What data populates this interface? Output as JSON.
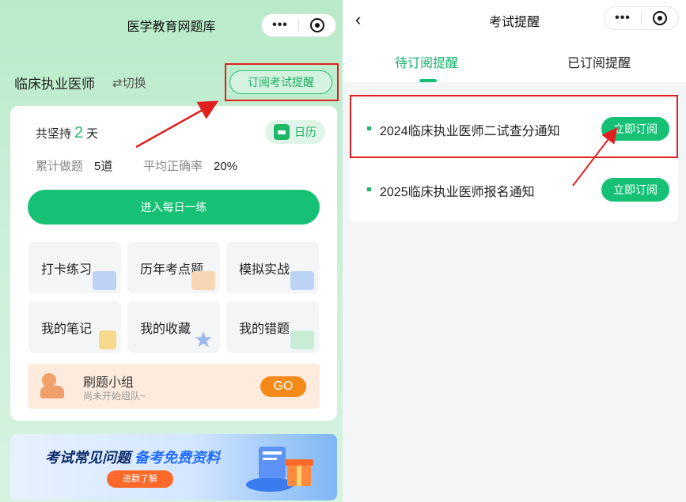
{
  "left_screen": {
    "nav_title": "医学教育网题库",
    "capsule": {
      "more_glyph": "•••"
    },
    "profession": "临床执业医师",
    "switch_label": "⇄切换",
    "subscribe_button": "订阅考试提醒",
    "persist": {
      "prefix": "共坚持",
      "days": "2",
      "suffix": "天"
    },
    "calendar_button": "日历",
    "stats": {
      "total_label": "累计做题",
      "total_value": "5道",
      "accuracy_label": "平均正确率",
      "accuracy_value": "20%"
    },
    "daily_button": "进入每日一练",
    "tiles": [
      {
        "label": "打卡练习",
        "icon": "calendar-chart-icon"
      },
      {
        "label": "历年考点题",
        "icon": "document-icon"
      },
      {
        "label": "模拟实战",
        "icon": "trend-chart-icon"
      },
      {
        "label": "我的笔记",
        "icon": "note-icon"
      },
      {
        "label": "我的收藏",
        "icon": "star-icon"
      },
      {
        "label": "我的错题",
        "icon": "error-book-icon"
      }
    ],
    "group": {
      "title": "刷题小组",
      "subtitle": "尚未开始组队~",
      "go_button": "GO"
    },
    "banner": {
      "text_dark": "考试常见问题",
      "text_blue": "备考免费资料",
      "button": "进群了解"
    }
  },
  "right_screen": {
    "back_glyph": "‹",
    "nav_title": "考试提醒",
    "capsule": {
      "more_glyph": "•••"
    },
    "tabs": [
      {
        "label": "待订阅提醒",
        "active": true
      },
      {
        "label": "已订阅提醒",
        "active": false
      }
    ],
    "items": [
      {
        "title": "2024临床执业医师二试查分通知",
        "button": "立即订阅"
      },
      {
        "title": "2025临床执业医师报名通知",
        "button": "立即订阅"
      }
    ]
  },
  "colors": {
    "accent_green": "#16c176",
    "annotation_red": "#e02020",
    "go_orange": "#f58a1a"
  }
}
